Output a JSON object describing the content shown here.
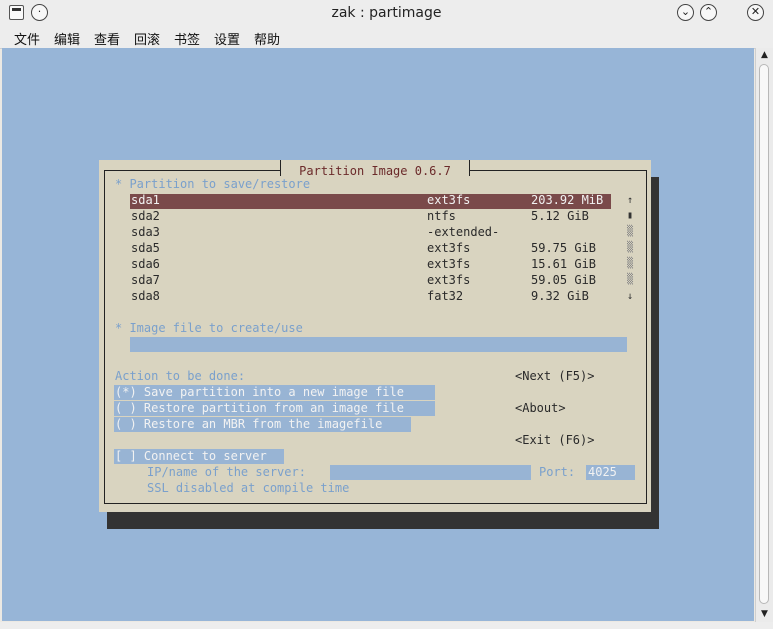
{
  "window": {
    "title": "zak : partimage",
    "menu": [
      "文件",
      "编辑",
      "查看",
      "回滚",
      "书签",
      "设置",
      "帮助"
    ]
  },
  "titlebar_buttons": {
    "minimize": "⌄",
    "maximize": "⌃",
    "close": "✕"
  },
  "dialog": {
    "title": "Partition Image 0.6.7",
    "partition_heading": "* Partition to save/restore",
    "partitions": [
      {
        "name": "sda1",
        "fs": "ext3fs",
        "size": "203.92 MiB",
        "selected": true
      },
      {
        "name": "sda2",
        "fs": "ntfs",
        "size": "5.12 GiB",
        "selected": false
      },
      {
        "name": "sda3",
        "fs": "-extended-",
        "size": "",
        "selected": false
      },
      {
        "name": "sda5",
        "fs": "ext3fs",
        "size": "59.75 GiB",
        "selected": false
      },
      {
        "name": "sda6",
        "fs": "ext3fs",
        "size": "15.61 GiB",
        "selected": false
      },
      {
        "name": "sda7",
        "fs": "ext3fs",
        "size": "59.05 GiB",
        "selected": false
      },
      {
        "name": "sda8",
        "fs": "fat32",
        "size": "9.32 GiB",
        "selected": false
      }
    ],
    "list_scroll": {
      "up": "↑",
      "thumb": "▮",
      "track": "▒",
      "down": "↓"
    },
    "image_heading": "* Image file to create/use",
    "image_value": "",
    "action_heading": "Action to be done:",
    "actions": [
      "(*) Save partition into a new image file",
      "( ) Restore partition from an image file",
      "( ) Restore an MBR from the imagefile"
    ],
    "next_button": "<Next (F5)>",
    "about_button": "<About>",
    "exit_button": "<Exit (F6)>",
    "connect_checkbox": "[ ] Connect to server",
    "server_label": "IP/name of the server:",
    "server_value": "",
    "port_label": "Port:",
    "port_value": "4025",
    "ssl_note": "SSL disabled at compile time"
  },
  "colors": {
    "terminal_bg": "#97b5d7",
    "dialog_bg": "#d9d4c0",
    "selection_bg": "#7a4a4a",
    "title_text": "#6b2a2a",
    "label_text": "#7aa0cc"
  }
}
